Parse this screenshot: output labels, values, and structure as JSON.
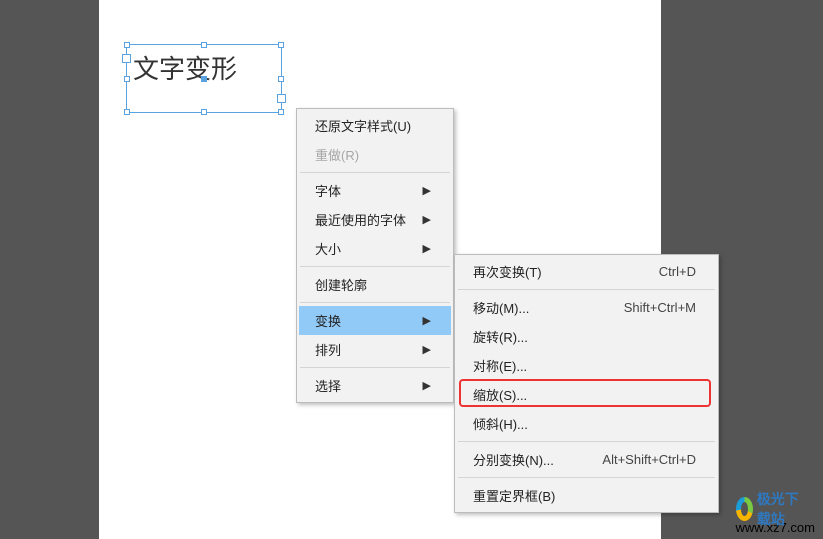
{
  "text_frame": {
    "content": "文字变形"
  },
  "menu1": {
    "items": [
      {
        "label": "还原文字样式(U)",
        "enabled": true,
        "submenu": false
      },
      {
        "label": "重做(R)",
        "enabled": false,
        "submenu": false
      },
      {
        "sep": true
      },
      {
        "label": "字体",
        "enabled": true,
        "submenu": true
      },
      {
        "label": "最近使用的字体",
        "enabled": true,
        "submenu": true
      },
      {
        "label": "大小",
        "enabled": true,
        "submenu": true
      },
      {
        "sep": true
      },
      {
        "label": "创建轮廓",
        "enabled": true,
        "submenu": false
      },
      {
        "sep": true
      },
      {
        "label": "变换",
        "enabled": true,
        "submenu": true,
        "highlight": true
      },
      {
        "label": "排列",
        "enabled": true,
        "submenu": true
      },
      {
        "sep": true
      },
      {
        "label": "选择",
        "enabled": true,
        "submenu": true
      }
    ]
  },
  "menu2": {
    "items": [
      {
        "label": "再次变换(T)",
        "shortcut": "Ctrl+D"
      },
      {
        "sep": true
      },
      {
        "label": "移动(M)...",
        "shortcut": "Shift+Ctrl+M"
      },
      {
        "label": "旋转(R)...",
        "shortcut": ""
      },
      {
        "label": "对称(E)...",
        "shortcut": ""
      },
      {
        "label": "缩放(S)...",
        "shortcut": ""
      },
      {
        "label": "倾斜(H)...",
        "shortcut": ""
      },
      {
        "sep": true
      },
      {
        "label": "分别变换(N)...",
        "shortcut": "Alt+Shift+Ctrl+D"
      },
      {
        "sep": true
      },
      {
        "label": "重置定界框(B)",
        "shortcut": ""
      }
    ]
  },
  "watermark": {
    "title": "极光下载站",
    "url": "www.xz7.com"
  }
}
